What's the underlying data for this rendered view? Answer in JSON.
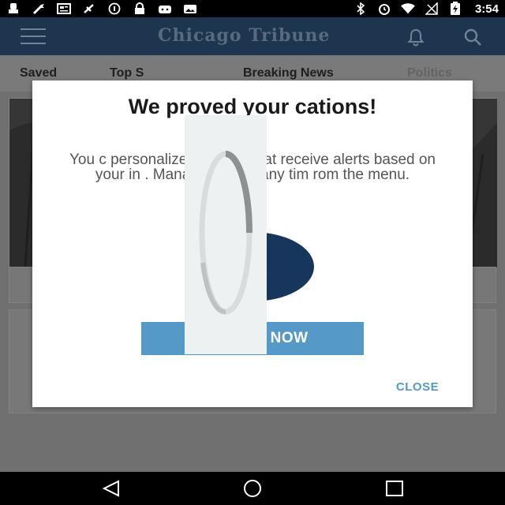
{
  "status_bar": {
    "time": "3:54",
    "left_icons": [
      "notification-icon",
      "wrench-icon",
      "news-icon",
      "satellite-icon",
      "circle-info-icon",
      "lock-icon",
      "android-icon",
      "photo-icon"
    ],
    "right_icons": [
      "bluetooth-icon",
      "alarm-icon",
      "wifi-icon",
      "no-signal-icon",
      "battery-charging-icon"
    ]
  },
  "app_bar": {
    "logo_text": "Chicago Tribune"
  },
  "tabs": {
    "saved": "Saved",
    "top": "Top S",
    "breaking": "Breaking News",
    "politics": "Politics"
  },
  "dialog": {
    "title": "We    proved your    cations!",
    "body": "You c      personalize your notificat      receive alerts based on your in      .  Manage now or any tim      rom the menu.",
    "manage_label": "MANAGE NOW",
    "close_label": "CLOSE"
  },
  "colors": {
    "app_bar": "#2a4a6e",
    "circle": "#17365c",
    "accent": "#5499c7"
  }
}
